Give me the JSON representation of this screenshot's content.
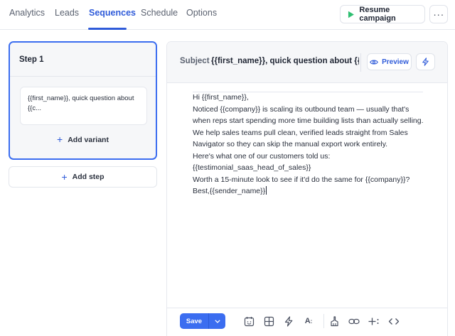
{
  "nav": {
    "tabs": [
      {
        "label": "Analytics"
      },
      {
        "label": "Leads"
      },
      {
        "label": "Sequences",
        "active": true
      },
      {
        "label": "Schedule"
      },
      {
        "label": "Options"
      }
    ],
    "resume_label": "Resume campaign",
    "more_label": "···"
  },
  "steps": {
    "step_title": "Step 1",
    "variant_preview": "{{first_name}}, quick question about {{c...",
    "add_variant_label": "Add variant",
    "add_step_label": "Add step"
  },
  "editor": {
    "subject_label": "Subject",
    "subject_value": "{{first_name}}, quick question about {{company}}",
    "preview_label": "Preview",
    "body_lines": [
      "Hi {{first_name}},",
      "Noticed {{company}} is scaling its outbound team — usually that's when reps start spending more time building lists than actually selling.",
      "We help sales teams pull clean, verified leads straight from Sales Navigator so they can skip the manual export work entirely.",
      "Here's what one of our customers told us:",
      "{{testimonial_saas_head_of_sales}}",
      "Worth a 15-minute look to see if it'd do the same for {{company}}?",
      "Best,{{sender_name}}"
    ]
  },
  "toolbar": {
    "save_label": "Save",
    "tools": [
      "calendar-icon",
      "layout-icon",
      "lightning-icon",
      "font-size-icon",
      "cleaner-icon",
      "link-icon",
      "insert-variable-icon",
      "code-icon"
    ]
  },
  "colors": {
    "accent": "#3b6df0",
    "active_tab": "#2f5bd9",
    "play_green": "#2fbf71"
  }
}
